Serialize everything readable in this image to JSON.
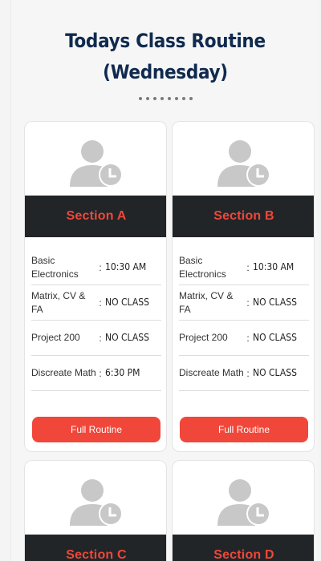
{
  "header": {
    "title_line1": "Todays Class Routine",
    "title_line2": "(Wednesday)"
  },
  "colors": {
    "title": "#102a4f",
    "accent": "#f0473a",
    "section_bar": "#222528",
    "avatar": "#c8c8c8"
  },
  "icon": "user-clock-icon",
  "button_label": "Full Routine",
  "sections": [
    {
      "label": "Section A",
      "rows": [
        {
          "subject": "Basic Electronics",
          "time": "10:30 AM"
        },
        {
          "subject": "Matrix, CV & FA",
          "time": "NO CLASS"
        },
        {
          "subject": "Project 200",
          "time": "NO CLASS"
        },
        {
          "subject": "Discreate Math",
          "time": "6:30 PM"
        }
      ]
    },
    {
      "label": "Section B",
      "rows": [
        {
          "subject": "Basic Electronics",
          "time": "10:30 AM"
        },
        {
          "subject": "Matrix, CV & FA",
          "time": "NO CLASS"
        },
        {
          "subject": "Project 200",
          "time": "NO CLASS"
        },
        {
          "subject": "Discreate Math",
          "time": "NO CLASS"
        }
      ]
    },
    {
      "label": "Section C"
    },
    {
      "label": "Section D"
    }
  ]
}
